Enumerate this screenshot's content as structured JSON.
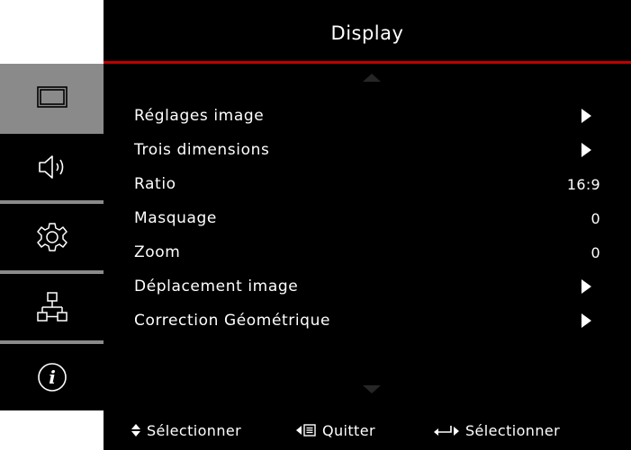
{
  "header": {
    "title": "Display"
  },
  "sidebar": {
    "items": [
      {
        "icon": "display-icon",
        "active": true
      },
      {
        "icon": "speaker-icon",
        "active": false
      },
      {
        "icon": "gear-icon",
        "active": false
      },
      {
        "icon": "network-icon",
        "active": false
      },
      {
        "icon": "info-icon",
        "active": false
      }
    ]
  },
  "menu": {
    "items": [
      {
        "label": "Réglages image",
        "value": null,
        "submenu": true
      },
      {
        "label": "Trois dimensions",
        "value": null,
        "submenu": true
      },
      {
        "label": "Ratio",
        "value": "16:9",
        "submenu": false
      },
      {
        "label": "Masquage",
        "value": "0",
        "submenu": false
      },
      {
        "label": "Zoom",
        "value": "0",
        "submenu": false
      },
      {
        "label": "Déplacement image",
        "value": null,
        "submenu": true
      },
      {
        "label": "Correction Géométrique",
        "value": null,
        "submenu": true
      }
    ]
  },
  "footer": {
    "select_updown": "Sélectionner",
    "quit": "Quitter",
    "select_enter": "Sélectionner"
  },
  "colors": {
    "accent": "#c00000",
    "active_tab": "#8a8a8a",
    "background": "#000000"
  }
}
